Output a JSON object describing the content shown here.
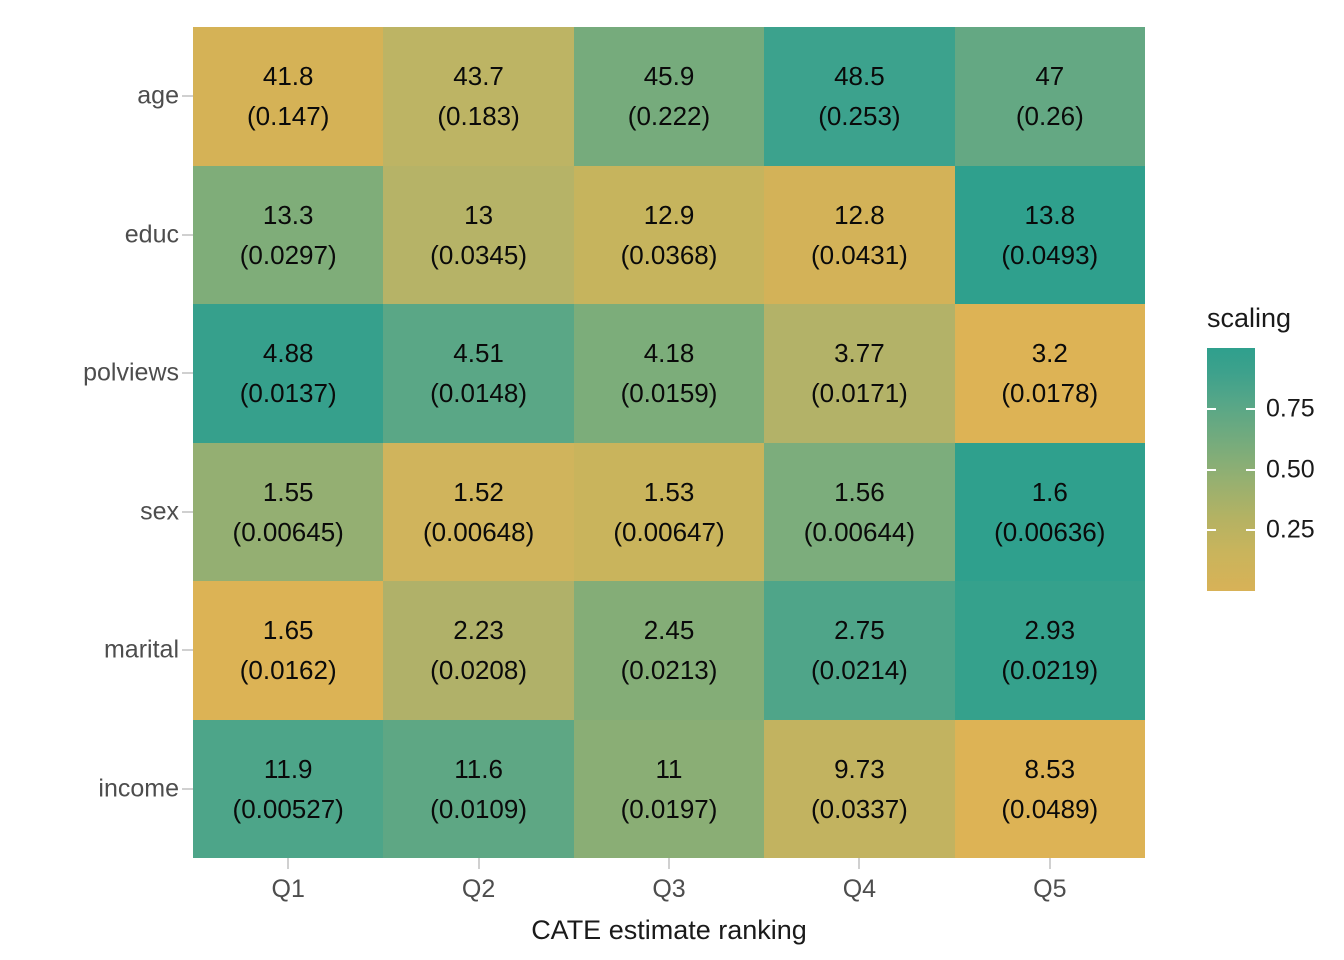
{
  "chart_data": {
    "type": "heatmap",
    "title": "",
    "xlabel": "CATE estimate ranking",
    "ylabel": "",
    "categories": [
      "Q1",
      "Q2",
      "Q3",
      "Q4",
      "Q5"
    ],
    "rows": [
      "age",
      "educ",
      "polviews",
      "sex",
      "marital",
      "income"
    ],
    "legend": {
      "title": "scaling",
      "position": "right",
      "ticks": [
        "0.75",
        "0.50",
        "0.25"
      ],
      "tick_values": [
        0.75,
        0.5,
        0.25
      ],
      "range": [
        0.0,
        1.0
      ],
      "low_color": "#d8b257",
      "high_color": "#2fa08d"
    },
    "grid": false,
    "cell_label_format": "estimate\n(std. error)",
    "cells": [
      [
        {
          "estimate": "41.8",
          "se": "(0.147)",
          "scaling": 0.0,
          "color": "#d5b256"
        },
        {
          "estimate": "43.7",
          "se": "(0.183)",
          "scaling": 0.28,
          "color": "#bdb464"
        },
        {
          "estimate": "45.9",
          "se": "(0.222)",
          "scaling": 0.61,
          "color": "#76ab7c"
        },
        {
          "estimate": "48.5",
          "se": "(0.253)",
          "scaling": 1.0,
          "color": "#3ca28d"
        },
        {
          "estimate": "47",
          "se": "(0.26)",
          "scaling": 0.78,
          "color": "#64a883"
        }
      ],
      [
        {
          "estimate": "13.3",
          "se": "(0.0297)",
          "scaling": 0.5,
          "color": "#7fad79"
        },
        {
          "estimate": "13",
          "se": "(0.0345)",
          "scaling": 0.2,
          "color": "#b6b367"
        },
        {
          "estimate": "12.9",
          "se": "(0.0368)",
          "scaling": 0.1,
          "color": "#c6b45d"
        },
        {
          "estimate": "12.8",
          "se": "(0.0431)",
          "scaling": 0.0,
          "color": "#d3b258"
        },
        {
          "estimate": "13.8",
          "se": "(0.0493)",
          "scaling": 1.0,
          "color": "#2fa08d"
        }
      ],
      [
        {
          "estimate": "4.88",
          "se": "(0.0137)",
          "scaling": 1.0,
          "color": "#36a08c"
        },
        {
          "estimate": "4.51",
          "se": "(0.0148)",
          "scaling": 0.78,
          "color": "#5aa786"
        },
        {
          "estimate": "4.18",
          "se": "(0.0159)",
          "scaling": 0.58,
          "color": "#7cad7a"
        },
        {
          "estimate": "3.77",
          "se": "(0.0171)",
          "scaling": 0.34,
          "color": "#b3b268"
        },
        {
          "estimate": "3.2",
          "se": "(0.0178)",
          "scaling": 0.0,
          "color": "#ddb355"
        }
      ],
      [
        {
          "estimate": "1.55",
          "se": "(0.00645)",
          "scaling": 0.43,
          "color": "#94af72"
        },
        {
          "estimate": "1.52",
          "se": "(0.00648)",
          "scaling": 0.0,
          "color": "#d0b45c"
        },
        {
          "estimate": "1.53",
          "se": "(0.00647)",
          "scaling": 0.14,
          "color": "#c9b45c"
        },
        {
          "estimate": "1.56",
          "se": "(0.00644)",
          "scaling": 0.57,
          "color": "#7cad7c"
        },
        {
          "estimate": "1.6",
          "se": "(0.00636)",
          "scaling": 1.0,
          "color": "#2fa08d"
        }
      ],
      [
        {
          "estimate": "1.65",
          "se": "(0.0162)",
          "scaling": 0.0,
          "color": "#dcb355"
        },
        {
          "estimate": "2.23",
          "se": "(0.0208)",
          "scaling": 0.45,
          "color": "#b0b169"
        },
        {
          "estimate": "2.45",
          "se": "(0.0213)",
          "scaling": 0.63,
          "color": "#84ad77"
        },
        {
          "estimate": "2.75",
          "se": "(0.0214)",
          "scaling": 0.86,
          "color": "#4fa589"
        },
        {
          "estimate": "2.93",
          "se": "(0.0219)",
          "scaling": 1.0,
          "color": "#35a18c"
        }
      ],
      [
        {
          "estimate": "11.9",
          "se": "(0.00527)",
          "scaling": 1.0,
          "color": "#4da589"
        },
        {
          "estimate": "11.6",
          "se": "(0.0109)",
          "scaling": 0.91,
          "color": "#5ea784"
        },
        {
          "estimate": "11",
          "se": "(0.0197)",
          "scaling": 0.73,
          "color": "#8aae75"
        },
        {
          "estimate": "9.73",
          "se": "(0.0337)",
          "scaling": 0.36,
          "color": "#c2b360"
        },
        {
          "estimate": "8.53",
          "se": "(0.0489)",
          "scaling": 0.0,
          "color": "#ddb355"
        }
      ]
    ]
  }
}
